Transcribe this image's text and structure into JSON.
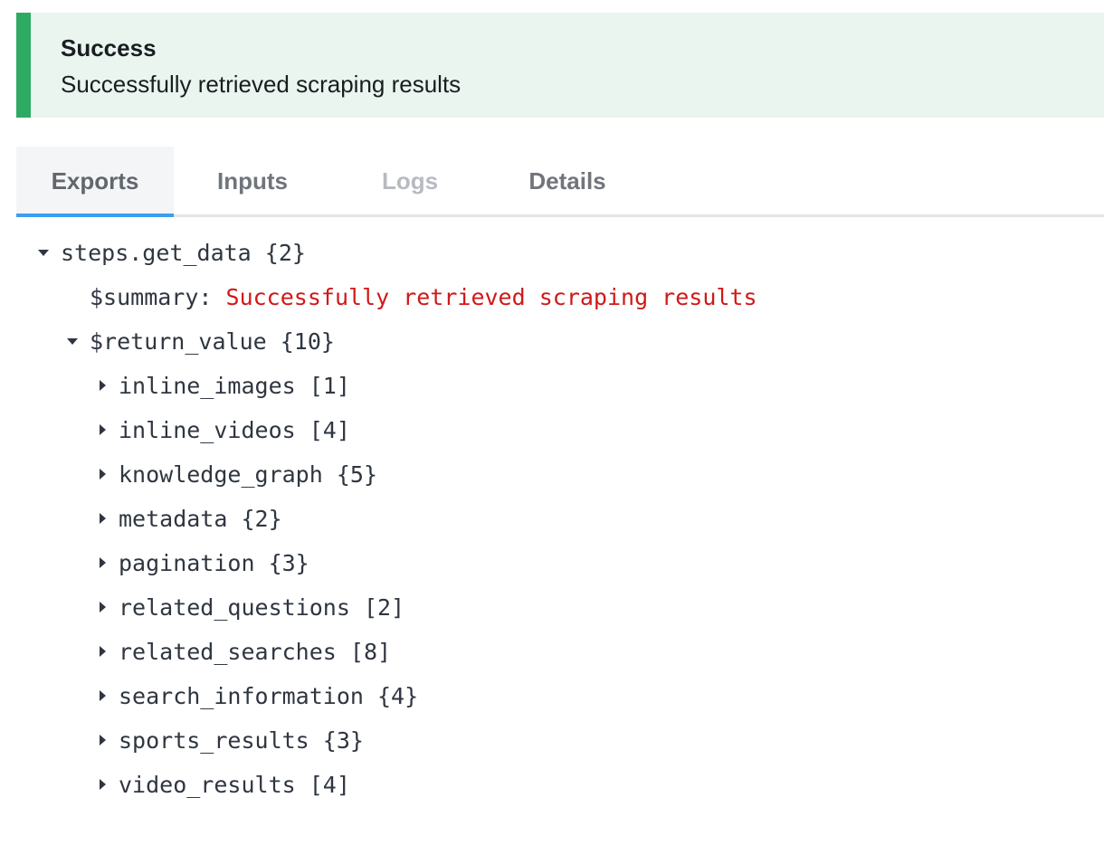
{
  "alert": {
    "title": "Success",
    "message": "Successfully retrieved scraping results",
    "accent_color": "#2eaa63"
  },
  "tabs": [
    {
      "label": "Exports",
      "state": "active"
    },
    {
      "label": "Inputs",
      "state": "normal"
    },
    {
      "label": "Logs",
      "state": "disabled"
    },
    {
      "label": "Details",
      "state": "normal"
    }
  ],
  "tree": {
    "root": {
      "key": "steps.get_data",
      "count": "{2}",
      "expanded": true
    },
    "summary": {
      "key": "$summary:",
      "value": "Successfully retrieved scraping results"
    },
    "return_value": {
      "key": "$return_value",
      "count": "{10}",
      "expanded": true
    },
    "children": [
      {
        "key": "inline_images",
        "count": "[1]"
      },
      {
        "key": "inline_videos",
        "count": "[4]"
      },
      {
        "key": "knowledge_graph",
        "count": "{5}"
      },
      {
        "key": "metadata",
        "count": "{2}"
      },
      {
        "key": "pagination",
        "count": "{3}"
      },
      {
        "key": "related_questions",
        "count": "[2]"
      },
      {
        "key": "related_searches",
        "count": "[8]"
      },
      {
        "key": "search_information",
        "count": "{4}"
      },
      {
        "key": "sports_results",
        "count": "{3}"
      },
      {
        "key": "video_results",
        "count": "[4]"
      }
    ]
  }
}
